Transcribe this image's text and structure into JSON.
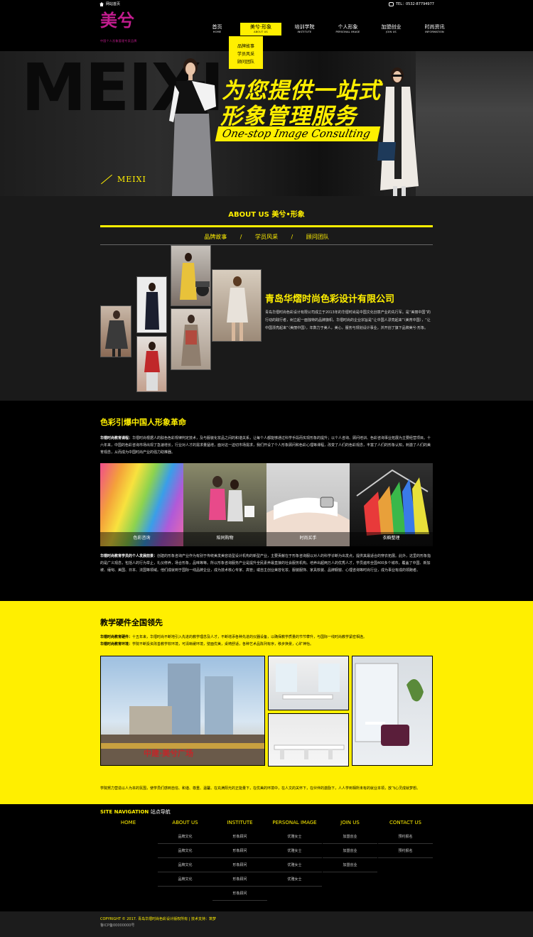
{
  "topbar": {
    "home": "网站首页",
    "tel": "TEL：0532-87794977"
  },
  "logo": {
    "text": "美兮",
    "sub": "中国个人形象管理专家品牌"
  },
  "nav": [
    {
      "cn": "首页",
      "en": "HOME"
    },
    {
      "cn": "美兮·形象",
      "en": "ABOUT US"
    },
    {
      "cn": "培训学院",
      "en": "INSTITUTE"
    },
    {
      "cn": "个人形象",
      "en": "PERSONAL IMAGE"
    },
    {
      "cn": "加盟创业",
      "en": "JOIN US"
    },
    {
      "cn": "时尚资讯",
      "en": "INFORMATION"
    }
  ],
  "dropdown": [
    "品牌故事",
    "学员风采",
    "顾问团队"
  ],
  "banner": {
    "bg_text": "MEIXI",
    "small": "MEIXI",
    "line1": "为您提供一站式",
    "line2": "形象管理服务",
    "en": "One-stop Image Consulting"
  },
  "about": {
    "title": "ABOUT US 美兮•形象",
    "tabs": [
      "品牌故事",
      "/",
      "学员风采",
      "/",
      "顾问团队"
    ],
    "company": "青岛华熠时尚色彩设计有限公司",
    "desc": "青岛华熠时尚色彩设计有限公司成立于2013年的华熠时尚是中国文化创意产业的先行军。是“美丽中国”的行动的践行者，树立起一面独特的品牌旗帜。华熠时尚的企业宗旨是“让中国人漂亮起来”（美育中国），“让中国漂亮起来”（美丽中国），年数力于美人，美心，服务与规划设计事业，并开创了旗下品牌美兮·形象。"
  },
  "color": {
    "title": "色彩引爆中国人形象革命",
    "p1_bold": "华熠时尚教育课程：",
    "p1": "华熠时尚根据人的肤色色彩规律判定技术，及与服装化妆品之间的和谐关系，让每个人都能够通过科学手段而实现形象的提升；以个人咨询、顾问培训、色彩咨询事业拓展为主要经营项目。十六年来，中国的色彩咨询市场出现了急速增长，行业对人才的需求量猛增，面对这一迫切市场需求，我们开设了个人形象顾问和色彩心理等课程，改变了人们的色彩观念，丰富了人们的形象认知，刺激了人们的美育观念，从而成为中国时尚产业的强力助推器。",
    "tiles": [
      "色彩咨询",
      "陪同购物",
      "时尚买手",
      "衣橱整理"
    ],
    "p2_bold": "华熠时尚教育学员的个人发展前景：",
    "p2": "创建的形象咨询产业作为有别于传统美发美容造型设计机构的新型产业，主要贡献在于形象咨询服以对人的科学诊断为出发点，提供其最适合的穿衣拓展。此外，这里的形象指的是广义观念，包括人的行为举止，礼仪修养，场合形象，品味等等。所以形象咨询服务产业是提升全民素养最直接的社会服务机构。培养出超两万人的优秀人才，学员遍布全国400多个城市，覆盖了中国、新加坡、缅甸、美国、日本、法国等领域。他们成就到于国际一线品牌企业，成为技术核心专家、高管；或自主创业美容化妆、服装服饰、家具软装、品牌橱窗、心理咨询等时尚行业，成为事业有成的领跑者。"
  },
  "hw": {
    "title": "教学硬件全国领先",
    "l1_bold": "华熠时尚教育硬件：",
    "l1": "十五年来，华熠时尚不断地引入先进的教学理念及人才，不断增添各种先进的仪器设备，以确保教学质量的节节攀升，与国际一线时尚教学紧密相连。",
    "l2_bold": "华熠时尚教育环境：",
    "l2": "学院不断投资改善教学软环境，可清晰缓环境，璧面优美，桌椅舒适，各种艺术品陈列有序，移步换景，心旷神怡。",
    "p3": "学院努力营造以人为本的氛围，使学员们感到自信、和谐、尊重、温馨。在充满阳光的正能量下，在优美的环境中，在人文的关怀下，在伙伴的激励下，人人学到相所未有的就业本领，放飞心灵成就梦想。",
    "building_sign": "中建·美兮广场"
  },
  "footer": {
    "title_en": "SITE NAVIGATION",
    "title_cn": "站点导航",
    "cols": [
      {
        "h": "HOME",
        "items": []
      },
      {
        "h": "ABOUT US",
        "items": [
          "品牌文化",
          "品牌文化",
          "品牌文化",
          "品牌文化"
        ]
      },
      {
        "h": "INSTITUTE",
        "items": [
          "形象顾问",
          "形象顾问",
          "形象顾问",
          "形象顾问",
          "形象顾问"
        ]
      },
      {
        "h": "PERSONAL IMAGE",
        "items": [
          "优雅女士",
          "优雅女士",
          "优雅女士",
          "优雅女士"
        ]
      },
      {
        "h": "JOIN US",
        "items": [
          "加盟创业",
          "加盟创业",
          "加盟创业"
        ]
      },
      {
        "h": "CONTACT US",
        "items": [
          "预约报名",
          "预约报名"
        ]
      }
    ],
    "copyright": "COPYRIGHT © 2017. 青岛华熠时尚色彩设计版权所有 | 技术支持：筑梦",
    "icp": "鲁ICP备00000000号"
  },
  "colors": {
    "accent": "#ffef00",
    "logo": "#c21c8e",
    "bg": "#000000",
    "about_bg": "#1a1a1a"
  }
}
